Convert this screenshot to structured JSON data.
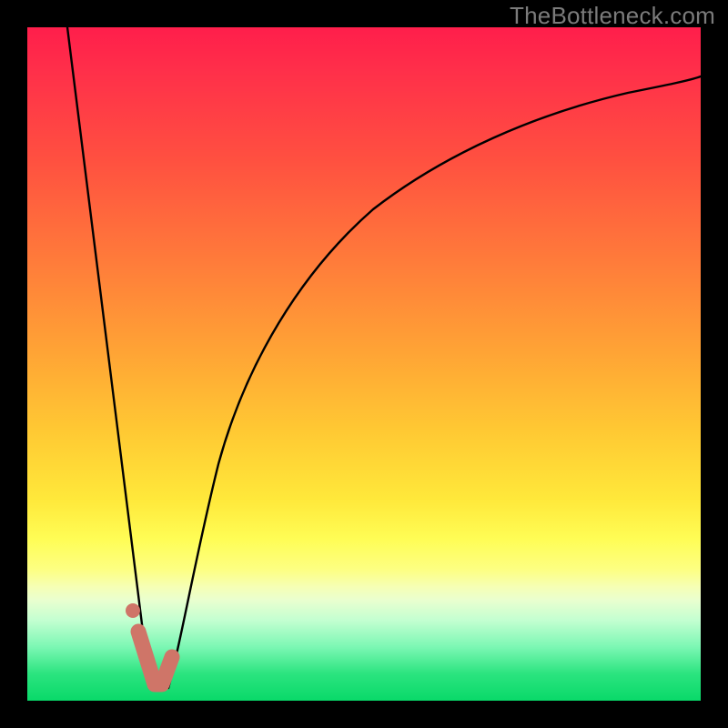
{
  "watermark": "TheBottleneck.com",
  "chart_data": {
    "type": "line",
    "title": "",
    "xlabel": "",
    "ylabel": "",
    "xlim": [
      0,
      100
    ],
    "ylim": [
      0,
      100
    ],
    "series": [
      {
        "name": "left-descent",
        "x": [
          6,
          18
        ],
        "values": [
          100,
          4
        ]
      },
      {
        "name": "right-curve",
        "x": [
          21,
          24,
          28,
          33,
          40,
          50,
          62,
          76,
          90,
          100
        ],
        "values": [
          2,
          14,
          30,
          45,
          58,
          70,
          80,
          87,
          91,
          93
        ]
      },
      {
        "name": "marker-segment",
        "x": [
          16.5,
          19,
          20,
          21.5
        ],
        "values": [
          10,
          2.5,
          2.5,
          6.5
        ]
      },
      {
        "name": "marker-dot",
        "x": [
          15.6
        ],
        "values": [
          13.3
        ]
      }
    ],
    "colors": {
      "curves": "#000000",
      "marker": "#cf7568"
    }
  }
}
